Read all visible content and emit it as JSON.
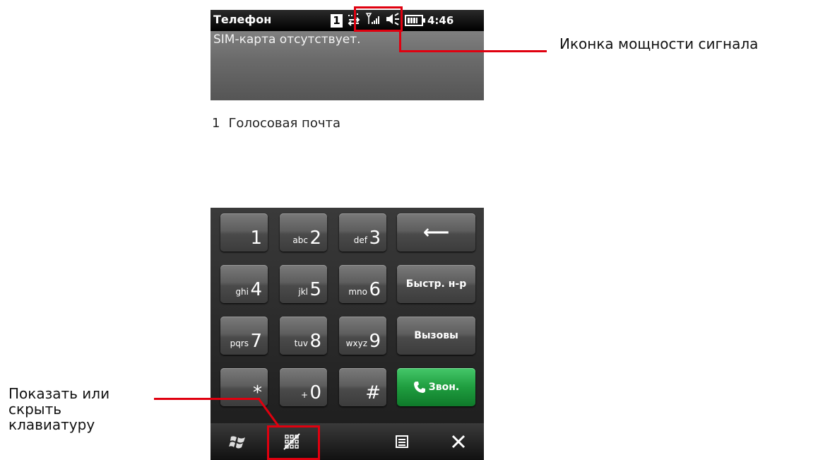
{
  "statusbar": {
    "app_title": "Телефон",
    "sim_slot": "1",
    "time": "4:46",
    "icons": [
      "sim-slot-icon",
      "connection-icon",
      "signal-strength-icon",
      "speaker-icon",
      "battery-icon"
    ]
  },
  "sim_banner": {
    "message": "SIM-карта отсутствует."
  },
  "speed_dial_list": [
    {
      "number": "1",
      "label": "Голосовая почта"
    }
  ],
  "keypad": {
    "keys": [
      {
        "digit": "1",
        "letters": ""
      },
      {
        "digit": "2",
        "letters": "abc"
      },
      {
        "digit": "3",
        "letters": "def"
      },
      {
        "digit": "4",
        "letters": "ghi"
      },
      {
        "digit": "5",
        "letters": "jkl"
      },
      {
        "digit": "6",
        "letters": "mno"
      },
      {
        "digit": "7",
        "letters": "pqrs"
      },
      {
        "digit": "8",
        "letters": "tuv"
      },
      {
        "digit": "9",
        "letters": "wxyz"
      },
      {
        "digit": "*",
        "letters": ""
      },
      {
        "digit": "0",
        "letters": "+"
      },
      {
        "digit": "#",
        "letters": ""
      }
    ],
    "backspace_symbol": "⟵",
    "speed_dial_label": "Быстр. н-р",
    "calls_label": "Вызовы",
    "call_label": "Звон."
  },
  "bottombar": {
    "start_icon": "windows-start-icon",
    "keyboard_toggle_icon": "keyboard-toggle-icon",
    "menu_icon": "menu-icon",
    "close_icon": "close-icon"
  },
  "annotations": {
    "signal_strength": "Иконка мощности сигнала",
    "keyboard_toggle_lines": [
      "Показать или",
      "скрыть",
      "клавиатуру"
    ]
  },
  "colors": {
    "annotation_red": "#e0000f",
    "call_green": "#1f9d3f"
  }
}
